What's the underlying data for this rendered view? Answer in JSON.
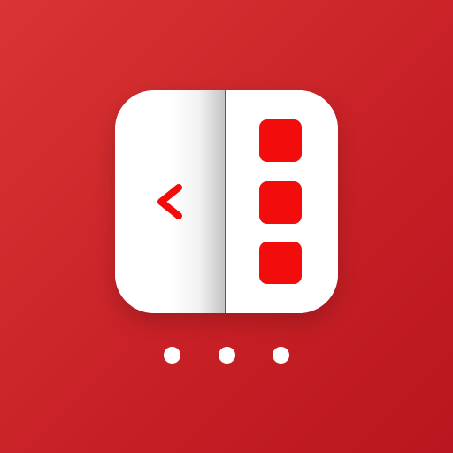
{
  "colors": {
    "background_start": "#d93534",
    "background_end": "#b9161f",
    "card": "#ffffff",
    "accent": "#f30c0c",
    "divider": "#cd2a2c"
  },
  "icons": {
    "back": "chevron-left-icon",
    "thumbnail": "rounded-square",
    "pager": "dot"
  },
  "content": {
    "thumbnail_count": 3,
    "pager_dot_count": 3
  }
}
